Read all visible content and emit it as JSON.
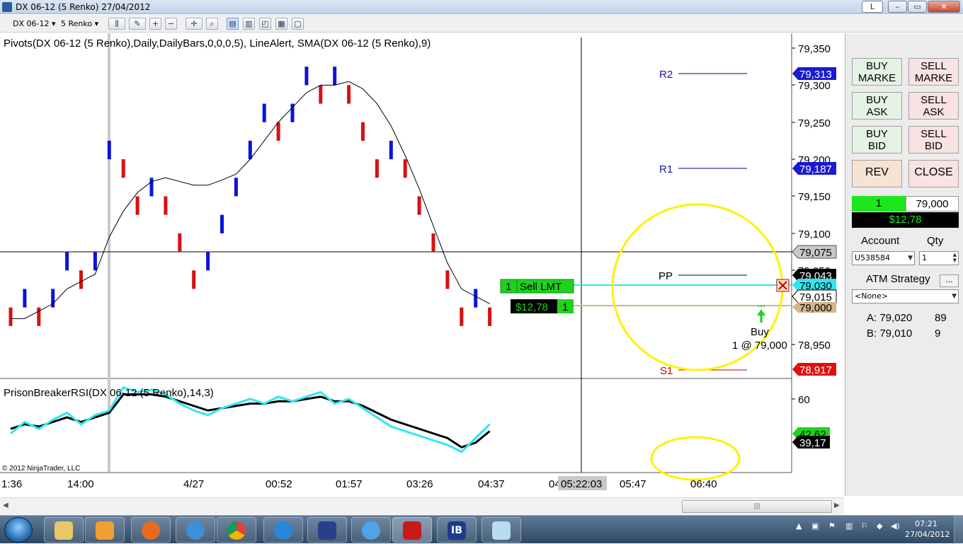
{
  "window": {
    "title": "DX 06-12 (5 Renko)  27/04/2012",
    "tab_label": "L",
    "controls": {
      "minimize": "–",
      "maximize": "▭",
      "close": "✕"
    }
  },
  "toolbar": {
    "instrument": "DX 06-12",
    "period": "5 Renko"
  },
  "chart": {
    "indicator_label": "Pivots(DX 06-12 (5 Renko),Daily,DailyBars,0,0,0,5), LineAlert, SMA(DX 06-12 (5 Renko),9)",
    "rsi_label": "PrisonBreakerRSI(DX 06-12 (5 Renko),14,3)",
    "copyright": "© 2012 NinjaTrader, LLC",
    "pivot_labels": {
      "r2": "R2",
      "r1": "R1",
      "pp": "PP",
      "s1": "S1"
    },
    "price_ticks": [
      "79,350",
      "79,300",
      "79,250",
      "79,200",
      "79,150",
      "79,100",
      "79,050",
      "78,950"
    ],
    "price_markers": {
      "r2": "79,313",
      "r1": "79,187",
      "crosshair": "79,075",
      "last": "79,043",
      "sell_lmt": "79,030",
      "sma": "79,015",
      "position": "79,000",
      "s1": "78,917"
    },
    "order_sell": {
      "qty": "1",
      "label": "Sell LMT"
    },
    "order_pnl": {
      "pnl": "$12,78",
      "qty": "1"
    },
    "execution": {
      "side": "Buy",
      "detail": "1 @ 79,000"
    },
    "rsi_ticks": [
      "60"
    ],
    "rsi_markers": {
      "fast": "42,62",
      "slow": "39,17"
    },
    "time_ticks": [
      "1:36",
      "14:00",
      "4/27",
      "00:52",
      "01:57",
      "03:26",
      "04:37",
      "04",
      "05:47",
      "06:40"
    ],
    "crosshair_time": "05:22:03",
    "colors": {
      "up": "#0a14d8",
      "down": "#d81010",
      "fast_rsi": "#2ee6f2",
      "highlight": "#fff200"
    },
    "chart_data": {
      "type": "bar",
      "title": "",
      "renko_bricks": [
        {
          "dir": "down",
          "close": 78.975
        },
        {
          "dir": "up",
          "close": 79.025
        },
        {
          "dir": "down",
          "close": 78.975
        },
        {
          "dir": "up",
          "close": 79.025
        },
        {
          "dir": "up",
          "close": 79.075
        },
        {
          "dir": "down",
          "close": 79.025
        },
        {
          "dir": "up",
          "close": 79.075
        },
        {
          "dir": "up",
          "close": 79.225
        },
        {
          "dir": "down",
          "close": 79.175
        },
        {
          "dir": "down",
          "close": 79.125
        },
        {
          "dir": "up",
          "close": 79.175
        },
        {
          "dir": "down",
          "close": 79.125
        },
        {
          "dir": "down",
          "close": 79.075
        },
        {
          "dir": "down",
          "close": 79.025
        },
        {
          "dir": "up",
          "close": 79.075
        },
        {
          "dir": "up",
          "close": 79.125
        },
        {
          "dir": "up",
          "close": 79.175
        },
        {
          "dir": "up",
          "close": 79.225
        },
        {
          "dir": "up",
          "close": 79.275
        },
        {
          "dir": "down",
          "close": 79.225
        },
        {
          "dir": "up",
          "close": 79.275
        },
        {
          "dir": "up",
          "close": 79.325
        },
        {
          "dir": "down",
          "close": 79.275
        },
        {
          "dir": "up",
          "close": 79.325
        },
        {
          "dir": "down",
          "close": 79.275
        },
        {
          "dir": "down",
          "close": 79.225
        },
        {
          "dir": "down",
          "close": 79.175
        },
        {
          "dir": "up",
          "close": 79.225
        },
        {
          "dir": "down",
          "close": 79.175
        },
        {
          "dir": "down",
          "close": 79.125
        },
        {
          "dir": "down",
          "close": 79.075
        },
        {
          "dir": "down",
          "close": 79.025
        },
        {
          "dir": "down",
          "close": 78.975
        },
        {
          "dir": "up",
          "close": 79.025
        },
        {
          "dir": "down",
          "close": 78.975
        }
      ],
      "sma_line": [
        78.985,
        78.985,
        78.995,
        79.005,
        79.025,
        79.035,
        79.045,
        79.095,
        79.13,
        79.155,
        79.17,
        79.175,
        79.17,
        79.165,
        79.165,
        79.172,
        79.18,
        79.2,
        79.225,
        79.25,
        79.27,
        79.29,
        79.3,
        79.3,
        79.305,
        79.295,
        79.275,
        79.245,
        79.205,
        79.16,
        79.11,
        79.06,
        79.025,
        79.015,
        79.005
      ],
      "rsi_fast": [
        45,
        50,
        47,
        51,
        54,
        49,
        53,
        55,
        65,
        63,
        64,
        62,
        58,
        55,
        53,
        56,
        58,
        60,
        58,
        61,
        59,
        61,
        63,
        58,
        60,
        56,
        52,
        48,
        46,
        44,
        42,
        40,
        37,
        43,
        49
      ],
      "rsi_slow": [
        47,
        49,
        48,
        50,
        52,
        50,
        52,
        54,
        62,
        62,
        62,
        61,
        59,
        57,
        55,
        56,
        57,
        58,
        58,
        59,
        59,
        60,
        61,
        59,
        59,
        57,
        54,
        51,
        49,
        47,
        45,
        43,
        39,
        41,
        46
      ],
      "price_range": [
        78.9,
        79.36
      ],
      "rsi_range": [
        28,
        68
      ]
    }
  },
  "panel": {
    "buy_market": "BUY\nMARKE",
    "sell_market": "SELL\nMARKE",
    "buy_ask": "BUY\nASK",
    "sell_ask": "SELL\nASK",
    "buy_bid": "BUY\nBID",
    "sell_bid": "SELL\nBID",
    "rev": "REV",
    "close": "CLOSE",
    "position_qty": "1",
    "position_price": "79,000",
    "position_pnl": "$12,78",
    "account_label": "Account",
    "qty_label": "Qty",
    "account_value": "U538584",
    "qty_value": "1",
    "atm_label": "ATM Strategy",
    "atm_button": "...",
    "atm_value": "<None>",
    "ask_label": "A: 79,020",
    "ask_size": "89",
    "bid_label": "B: 79,010",
    "bid_size": "9"
  },
  "taskbar": {
    "time": "07:21",
    "date": "27/04/2012"
  }
}
